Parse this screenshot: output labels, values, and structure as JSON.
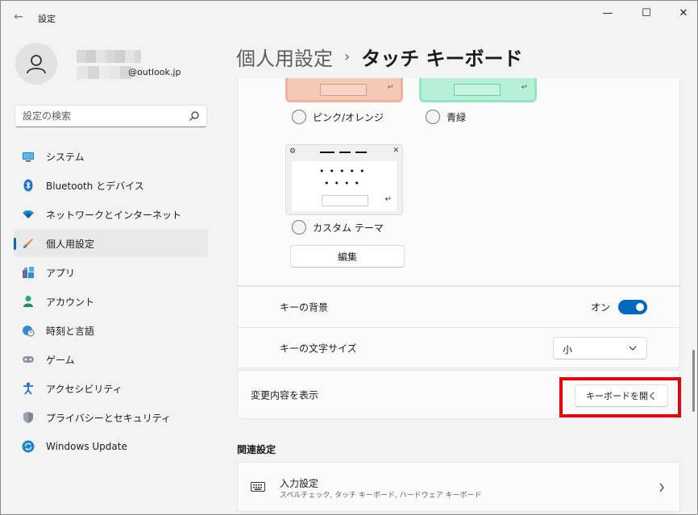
{
  "window": {
    "title": "設定",
    "back_glyph": "←",
    "minimize_glyph": "—",
    "maximize_glyph": "☐",
    "close_glyph": "✕"
  },
  "profile": {
    "email_suffix": "@outlook.jp"
  },
  "search": {
    "placeholder": "設定の検索"
  },
  "sidebar": {
    "items": [
      {
        "label": "システム",
        "icon": "monitor-icon"
      },
      {
        "label": "Bluetooth とデバイス",
        "icon": "bluetooth-icon"
      },
      {
        "label": "ネットワークとインターネット",
        "icon": "wifi-icon"
      },
      {
        "label": "個人用設定",
        "icon": "brush-icon",
        "active": true
      },
      {
        "label": "アプリ",
        "icon": "apps-icon"
      },
      {
        "label": "アカウント",
        "icon": "person-icon"
      },
      {
        "label": "時刻と言語",
        "icon": "globe-clock-icon"
      },
      {
        "label": "ゲーム",
        "icon": "gamepad-icon"
      },
      {
        "label": "アクセシビリティ",
        "icon": "accessibility-icon"
      },
      {
        "label": "プライバシーとセキュリティ",
        "icon": "shield-icon"
      },
      {
        "label": "Windows Update",
        "icon": "update-icon"
      }
    ]
  },
  "breadcrumb": {
    "parent": "個人用設定",
    "separator": "›",
    "current": "タッチ キーボード"
  },
  "themes": {
    "pink_label": "ピンク/オレンジ",
    "green_label": "青緑",
    "custom_label": "カスタム テーマ",
    "return_glyph": "↵",
    "gear_glyph": "⚙",
    "close_glyph": "✕",
    "dots_row1": "•••••",
    "dots_row2": "••••",
    "edit_button": "編集"
  },
  "settings": {
    "key_background": {
      "label": "キーの背景",
      "state_text": "オン",
      "on": true
    },
    "key_text_size": {
      "label": "キーの文字サイズ",
      "value": "小"
    },
    "preview": {
      "label": "変更内容を表示",
      "button": "キーボードを開く"
    }
  },
  "related": {
    "section_title": "関連設定",
    "items": [
      {
        "title": "入力設定",
        "subtitle": "スペルチェック, タッチ キーボード, ハードウェア キーボード"
      }
    ]
  },
  "colors": {
    "accent": "#0067c0",
    "highlight": "#e8000b"
  }
}
